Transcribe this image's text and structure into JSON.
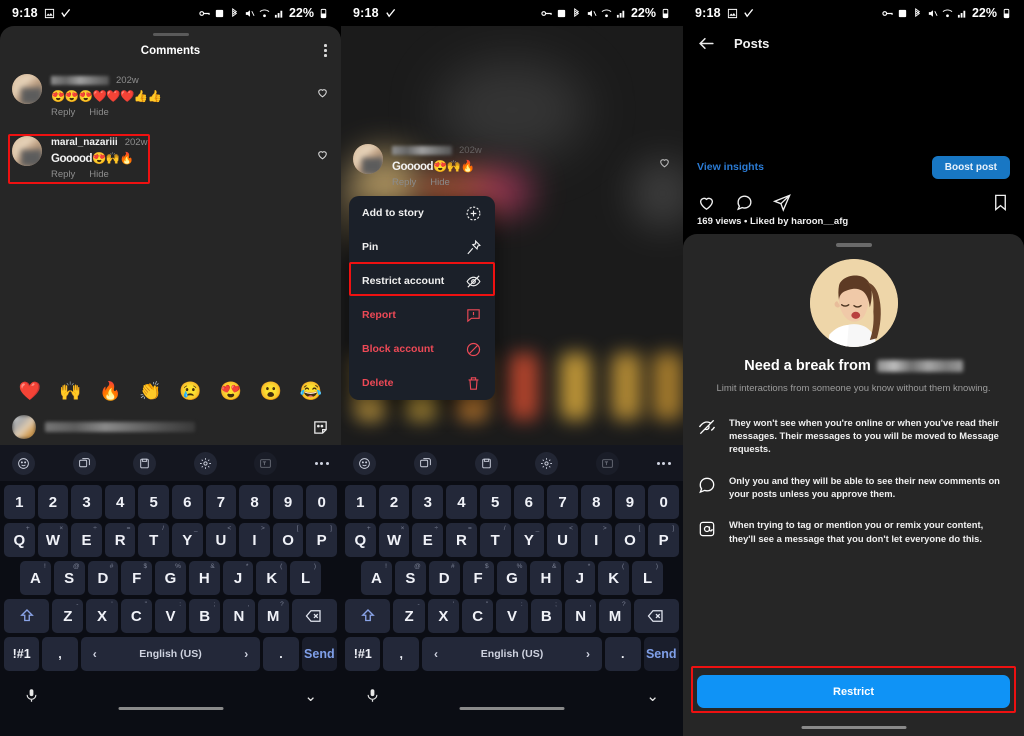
{
  "status_bar": {
    "time": "9:18",
    "battery": "22%",
    "icons": [
      "image-icon",
      "checkmark-icon",
      "vpn-key-icon",
      "alarm-icon",
      "bluetooth-icon",
      "mute-icon",
      "wifi-calling-icon",
      "signal-icon",
      "battery-icon"
    ]
  },
  "panel1": {
    "sheet_title": "Comments",
    "menu_icon": "kebab-menu-icon",
    "comments": [
      {
        "username": "",
        "username_blurred": true,
        "time": "202w",
        "text": "😍😍😍❤️❤️❤️👍👍",
        "reply": "Reply",
        "hide": "Hide"
      },
      {
        "username": "maral_nazariii",
        "username_blurred": false,
        "time": "202w",
        "text": "Gooood😍🙌🔥",
        "reply": "Reply",
        "hide": "Hide"
      }
    ],
    "quick_emojis": [
      "❤️",
      "🙌",
      "🔥",
      "👏",
      "😢",
      "😍",
      "😮",
      "😂"
    ],
    "input_placeholder": "",
    "sticker_icon": "sticker-icon"
  },
  "menu": {
    "items": [
      {
        "label": "Add to story",
        "icon": "add-to-story-icon",
        "danger": false
      },
      {
        "label": "Pin",
        "icon": "pin-icon",
        "danger": false
      },
      {
        "label": "Restrict account",
        "icon": "restrict-eye-off-icon",
        "danger": false,
        "highlighted": true
      },
      {
        "label": "Report",
        "icon": "report-exclamation-icon",
        "danger": true
      },
      {
        "label": "Block account",
        "icon": "block-circle-slash-icon",
        "danger": true
      },
      {
        "label": "Delete",
        "icon": "trash-icon",
        "danger": true
      }
    ]
  },
  "panel3": {
    "back_icon": "back-arrow-icon",
    "title": "Posts",
    "view_insights": "View insights",
    "boost_post": "Boost post",
    "actions": [
      "heart-icon",
      "comment-icon",
      "share-icon",
      "bookmark-icon"
    ],
    "views_line": "169 views • Liked by haroon__afg",
    "sheet": {
      "illustration": "woman-resting-illustration",
      "title_prefix": "Need a break from",
      "title_name_blurred": true,
      "subtitle": "Limit interactions from someone you know without them knowing.",
      "bullets": [
        {
          "icon": "eye-off-icon",
          "text": "They won't see when you're online or when you've read their messages. Their messages to you will be moved to Message requests."
        },
        {
          "icon": "comment-icon",
          "text": "Only you and they will be able to see their new comments on your posts unless you approve them."
        },
        {
          "icon": "mention-at-icon",
          "text": "When trying to tag or mention you or remix your content, they'll see a message that you don't let everyone do this."
        }
      ],
      "primary_button": "Restrict"
    }
  },
  "keyboard": {
    "toolbar_icons": [
      "emoji-icon",
      "gif-sticker-icon",
      "clipboard-icon",
      "settings-gear-icon",
      "translate-icon",
      "more-dots-icon"
    ],
    "row_numbers": [
      "1",
      "2",
      "3",
      "4",
      "5",
      "6",
      "7",
      "8",
      "9",
      "0"
    ],
    "row_top": [
      "Q",
      "W",
      "E",
      "R",
      "T",
      "Y",
      "U",
      "I",
      "O",
      "P"
    ],
    "row_top_sup": [
      "+",
      "×",
      "÷",
      "=",
      "/",
      "_",
      "<",
      ">",
      "[",
      "]"
    ],
    "row_home": [
      "A",
      "S",
      "D",
      "F",
      "G",
      "H",
      "J",
      "K",
      "L"
    ],
    "row_home_sup": [
      "!",
      "@",
      "#",
      "$",
      "%",
      "&",
      "*",
      "(",
      ")"
    ],
    "row_bottom": [
      "Z",
      "X",
      "C",
      "V",
      "B",
      "N",
      "M"
    ],
    "row_bottom_sup": [
      "-",
      "'",
      "\"",
      ":",
      ";",
      ",",
      "?"
    ],
    "shift_icon": "shift-up-icon",
    "backspace_icon": "backspace-icon",
    "sym_key": "!#1",
    "comma_key": ",",
    "space_label": "English (US)",
    "space_prev": "‹",
    "space_next": "›",
    "period_key": ".",
    "send_key": "Send",
    "mic_icon": "microphone-icon",
    "hide_keyboard_icon": "chevron-down-icon"
  },
  "colors": {
    "accent_blue": "#0f93f6",
    "boost_blue": "#1877c4",
    "link_blue": "#2b7bd4",
    "danger_red": "#ed4956",
    "highlight_red": "#ee1111",
    "sheet_bg": "#262626",
    "keyboard_bg": "#0b0d14",
    "key_bg": "#232839"
  }
}
